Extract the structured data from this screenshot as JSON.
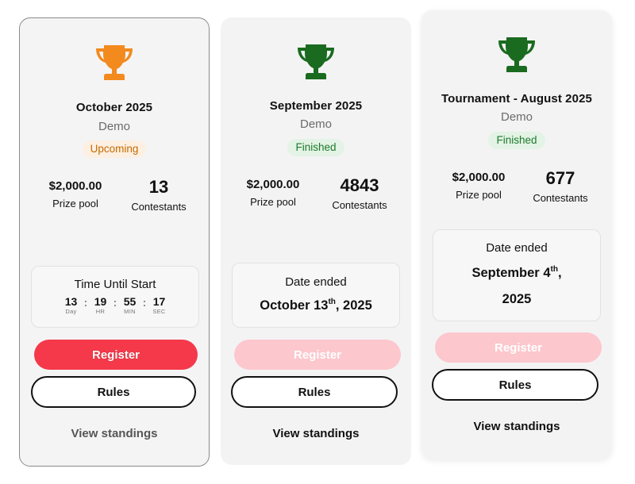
{
  "colors": {
    "trophy_upcoming": "#f28a1e",
    "trophy_finished": "#1a6b1f",
    "register_active": "#f5394a",
    "register_disabled": "#fcc7cd",
    "badge_upcoming_bg": "#fdf0e2",
    "badge_upcoming_text": "#c56a00",
    "badge_finished_bg": "#e3f3e5",
    "badge_finished_text": "#1e7a2c"
  },
  "cards": [
    {
      "icon": "trophy-icon",
      "title": "October 2025",
      "subtitle": "Demo",
      "status": "Upcoming",
      "prize_pool": "$2,000.00",
      "prize_pool_label": "Prize pool",
      "contestants": "13",
      "contestants_label": "Contestants",
      "timer_label": "Time Until Start",
      "countdown": [
        {
          "value": "13",
          "unit": "Day"
        },
        {
          "value": "19",
          "unit": "HR"
        },
        {
          "value": "55",
          "unit": "MIN"
        },
        {
          "value": "17",
          "unit": "SEC"
        }
      ],
      "register_label": "Register",
      "register_enabled": true,
      "rules_label": "Rules",
      "standings_label": "View standings"
    },
    {
      "icon": "trophy-icon",
      "title": "September 2025",
      "subtitle": "Demo",
      "status": "Finished",
      "prize_pool": "$2,000.00",
      "prize_pool_label": "Prize pool",
      "contestants": "4843",
      "contestants_label": "Contestants",
      "date_label": "Date ended",
      "date_main": "October 13",
      "date_suffix": "th",
      "date_year": ", 2025",
      "register_label": "Register",
      "register_enabled": false,
      "rules_label": "Rules",
      "standings_label": "View standings"
    },
    {
      "icon": "trophy-icon",
      "title": "Tournament - August 2025",
      "subtitle": "Demo",
      "status": "Finished",
      "prize_pool": "$2,000.00",
      "prize_pool_label": "Prize pool",
      "contestants": "677",
      "contestants_label": "Contestants",
      "date_label": "Date ended",
      "date_main": "September 4",
      "date_suffix": "th",
      "date_year_line": ",",
      "date_line2": "2025",
      "register_label": "Register",
      "register_enabled": false,
      "rules_label": "Rules",
      "standings_label": "View standings"
    }
  ]
}
